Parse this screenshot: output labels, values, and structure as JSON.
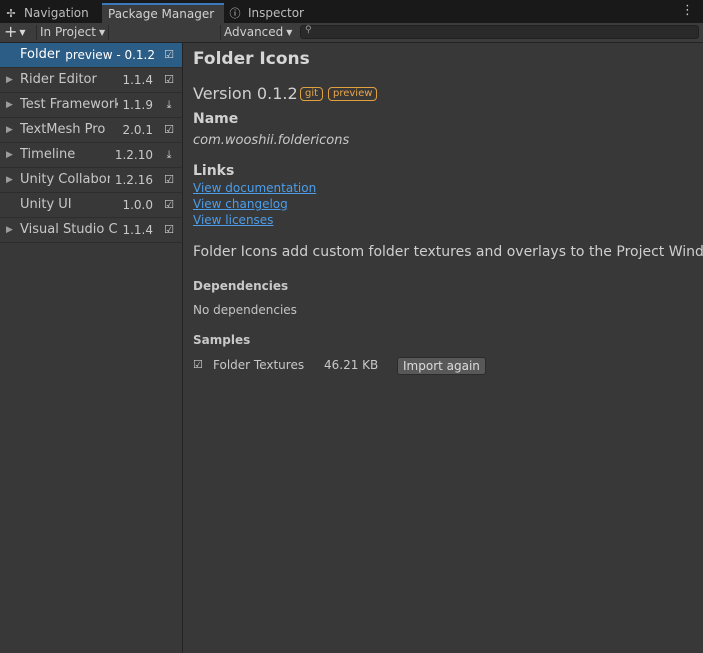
{
  "tabs": [
    {
      "label": "Navigation",
      "icon": "navigation-icon"
    },
    {
      "label": "Package Manager"
    },
    {
      "label": "Inspector",
      "icon": "info-icon"
    }
  ],
  "toolbar": {
    "add_label": "+",
    "filter_label": "In Project",
    "advanced_label": "Advanced",
    "search_placeholder": ""
  },
  "packages": [
    {
      "name": "Folder Icons",
      "version": "preview - 0.1.2",
      "status": "installed",
      "status_glyph": "☑",
      "selected": true,
      "expandable": false
    },
    {
      "name": "Rider Editor",
      "version": "1.1.4",
      "status": "installed",
      "status_glyph": "☑",
      "selected": false,
      "expandable": true
    },
    {
      "name": "Test Framework",
      "version": "1.1.9",
      "status": "update-available",
      "status_glyph": "⤓",
      "selected": false,
      "expandable": true
    },
    {
      "name": "TextMesh Pro",
      "version": "2.0.1",
      "status": "installed",
      "status_glyph": "☑",
      "selected": false,
      "expandable": true
    },
    {
      "name": "Timeline",
      "version": "1.2.10",
      "status": "update-available",
      "status_glyph": "⤓",
      "selected": false,
      "expandable": true
    },
    {
      "name": "Unity Collaborate",
      "version": "1.2.16",
      "status": "installed",
      "status_glyph": "☑",
      "selected": false,
      "expandable": true
    },
    {
      "name": "Unity UI",
      "version": "1.0.0",
      "status": "installed",
      "status_glyph": "☑",
      "selected": false,
      "expandable": false
    },
    {
      "name": "Visual Studio Code Editor",
      "version": "1.1.4",
      "status": "installed",
      "status_glyph": "☑",
      "selected": false,
      "expandable": true
    }
  ],
  "details": {
    "title": "Folder Icons",
    "version": "Version 0.1.2",
    "tags": [
      "git",
      "preview"
    ],
    "name_header": "Name",
    "package_id": "com.wooshii.foldericons",
    "links_header": "Links",
    "links": [
      "View documentation",
      "View changelog",
      "View licenses"
    ],
    "description": "Folder Icons add custom folder textures and overlays to the Project Window",
    "dependencies_header": "Dependencies",
    "dependencies_text": "No dependencies",
    "samples_header": "Samples",
    "samples": [
      {
        "name": "Folder Textures",
        "size": "46.21 KB",
        "button": "Import again",
        "imported": true
      }
    ]
  },
  "colors": {
    "accent": "#3a79bb",
    "selection": "#2c5d87",
    "link": "#4c9eea",
    "tag": "#e8a64a"
  }
}
